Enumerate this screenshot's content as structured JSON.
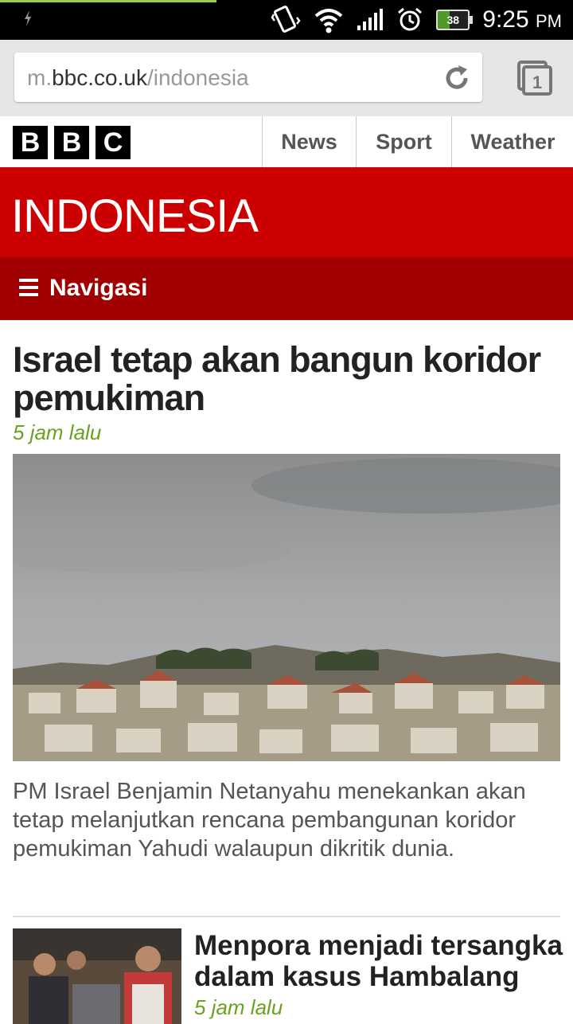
{
  "status_bar": {
    "time": "9:25",
    "ampm": "PM",
    "battery": "38",
    "icons": [
      "usb-icon",
      "vibrate-icon",
      "wifi-icon",
      "signal-icon",
      "alarm-icon",
      "battery-icon"
    ]
  },
  "browser": {
    "url_prefix": "m.",
    "url_domain": "bbc.co.uk",
    "url_path": "/indonesia",
    "tab_count": "1"
  },
  "bbc": {
    "logo_letters": [
      "B",
      "B",
      "C"
    ],
    "nav": [
      "News",
      "Sport",
      "Weather"
    ]
  },
  "section": {
    "title": "INDONESIA",
    "nav_label": "Navigasi"
  },
  "lead": {
    "title": "Israel tetap akan bangun koridor pemukiman",
    "time": "5 jam lalu",
    "summary": "PM Israel Benjamin Netanyahu menekankan akan tetap melanjutkan rencana pembangunan koridor pemukiman Yahudi walaupun dikritik dunia."
  },
  "story2": {
    "title": "Menpora menjadi tersangka dalam kasus Hambalang",
    "time": "5 jam lalu"
  },
  "colors": {
    "bbc_red": "#cc0000",
    "nav_red": "#a00000",
    "time_green": "#6aa121"
  }
}
